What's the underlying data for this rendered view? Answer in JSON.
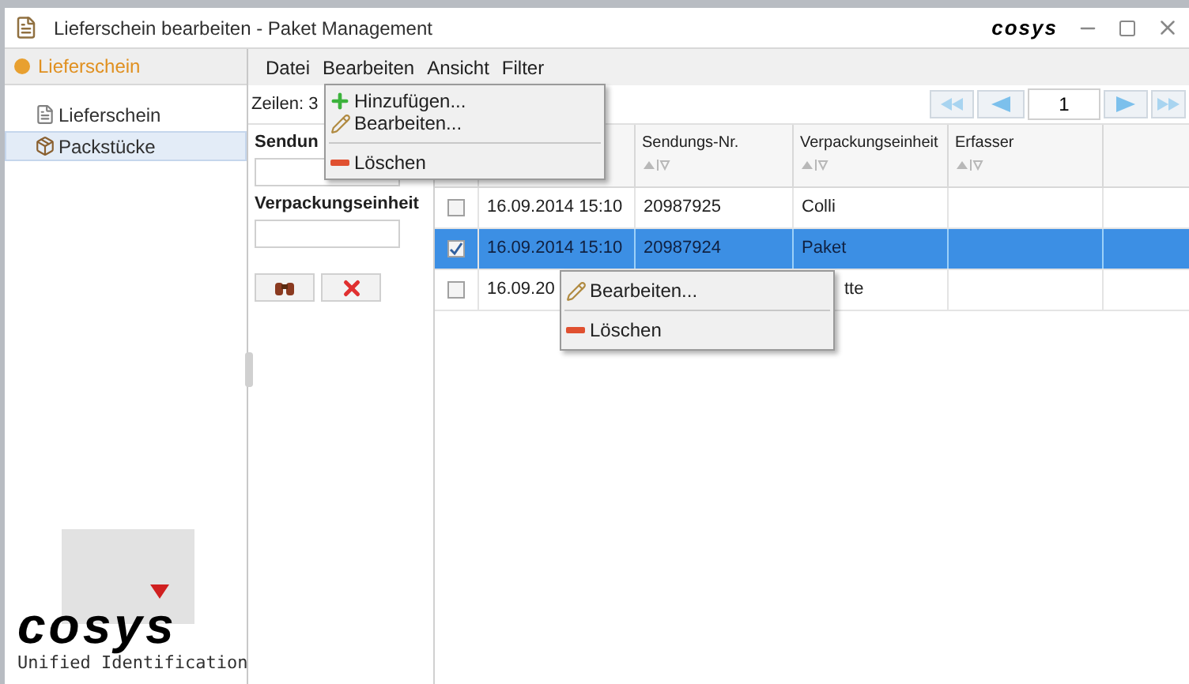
{
  "window": {
    "title": "Lieferschein bearbeiten - Paket Management",
    "brand": "cosys"
  },
  "sidebar": {
    "header": "Lieferschein",
    "items": [
      {
        "label": "Lieferschein",
        "kind": "document",
        "selected": false
      },
      {
        "label": "Packstücke",
        "kind": "package",
        "selected": true
      }
    ],
    "logo": {
      "text": "cosys",
      "tagline": "Unified Identification"
    }
  },
  "menu_bar": [
    "Datei",
    "Bearbeiten",
    "Ansicht",
    "Filter"
  ],
  "row_count": "Zeilen: 3",
  "pager": {
    "page": "1"
  },
  "filters": [
    {
      "label": "Sendun"
    },
    {
      "label": "Verpackungseinheit"
    }
  ],
  "table": {
    "columns": [
      {
        "label": "Sendungs-Nr."
      },
      {
        "label": "Verpackungseinheit"
      },
      {
        "label": "Erfasser"
      }
    ],
    "rows": [
      {
        "checked": false,
        "selected": false,
        "date": "16.09.2014 15:10",
        "cells": [
          {
            "text": "20987925"
          },
          {
            "text": "Colli"
          },
          {
            "text": ""
          }
        ]
      },
      {
        "checked": true,
        "selected": true,
        "date": "16.09.2014 15:10",
        "cells": [
          {
            "text": "20987924"
          },
          {
            "text": "Paket"
          },
          {
            "text": ""
          }
        ]
      },
      {
        "checked": false,
        "selected": false,
        "date": "16.09.20",
        "cells": [
          {
            "text": ""
          },
          {
            "text": "tte",
            "clipped": true
          },
          {
            "text": ""
          }
        ]
      }
    ]
  },
  "dropdown_menu": [
    {
      "kind": "add",
      "label": "Hinzufügen..."
    },
    {
      "kind": "edit",
      "label": "Bearbeiten..."
    },
    {
      "kind": "separator"
    },
    {
      "kind": "delete",
      "label": "Löschen"
    }
  ],
  "context_menu": [
    {
      "kind": "edit",
      "label": "Bearbeiten..."
    },
    {
      "kind": "separator"
    },
    {
      "kind": "delete",
      "label": "Löschen"
    }
  ]
}
